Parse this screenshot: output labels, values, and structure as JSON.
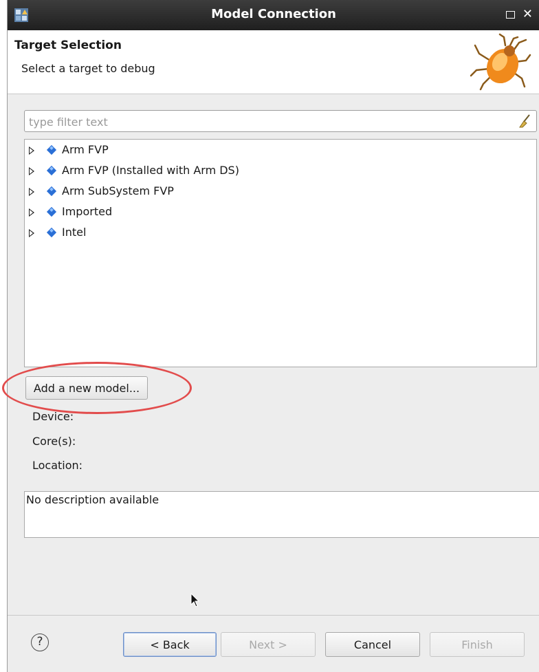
{
  "window": {
    "title": "Model Connection"
  },
  "header": {
    "title": "Target Selection",
    "subtitle": "Select a target to debug"
  },
  "filter": {
    "placeholder": "type filter text",
    "value": ""
  },
  "tree": {
    "items": [
      {
        "label": "Arm FVP"
      },
      {
        "label": "Arm FVP (Installed with Arm DS)"
      },
      {
        "label": "Arm SubSystem FVP"
      },
      {
        "label": "Imported"
      },
      {
        "label": "Intel"
      }
    ]
  },
  "add_model_label": "Add a new model...",
  "details": {
    "device_label": "Device:",
    "cores_label": "Core(s):",
    "location_label": "Location:"
  },
  "description": "No description available",
  "buttons": {
    "help": "?",
    "back": "< Back",
    "next": "Next >",
    "cancel": "Cancel",
    "finish": "Finish"
  },
  "colors": {
    "titlebar": "#2b2b2b",
    "dialog_bg": "#ededed",
    "highlight_oval": "#e24c4c",
    "tree_icon": "#2a6fd6"
  }
}
